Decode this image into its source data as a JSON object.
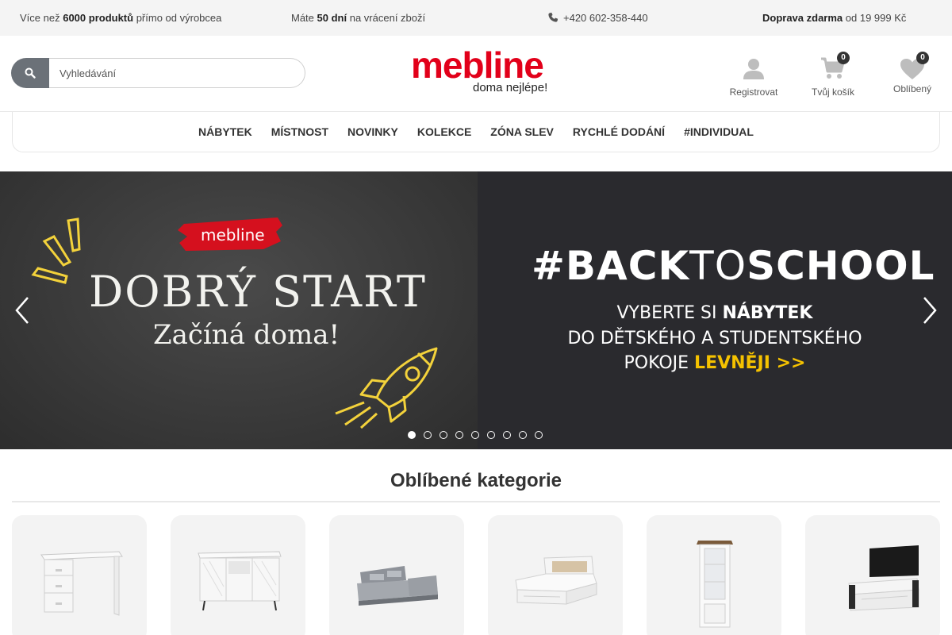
{
  "topbar": {
    "item1_prefix": "Více než",
    "item1_bold": "6000 produktů",
    "item1_suffix": "přímo od výrobcea",
    "item2_prefix": "Máte",
    "item2_bold": "50 dní",
    "item2_suffix": "na vrácení zboží",
    "phone": "+420 602-358-440",
    "phone_icon": "phone-icon",
    "item4_bold": "Doprava zdarma",
    "item4_suffix": "od 19 999 Kč"
  },
  "search": {
    "placeholder": "Vyhledávání",
    "icon": "search-icon"
  },
  "logo": {
    "main": "mebline",
    "tagline": "doma nejlépe!"
  },
  "header_actions": {
    "register": {
      "label": "Registrovat",
      "icon": "user-icon"
    },
    "cart": {
      "label": "Tvůj košík",
      "count": "0",
      "icon": "cart-icon"
    },
    "favorites": {
      "label": "Oblíbený",
      "count": "0",
      "icon": "heart-icon"
    }
  },
  "nav": {
    "items": [
      "NÁBYTEK",
      "MÍSTNOST",
      "NOVINKY",
      "KOLEKCE",
      "ZÓNA SLEV",
      "RYCHLÉ DODÁNÍ",
      "#INDIVIDUAL"
    ]
  },
  "hero": {
    "left": {
      "brand": "mebline",
      "title": "DOBRÝ START",
      "subtitle": "Začíná doma!"
    },
    "right": {
      "hashtag": "#",
      "back": "BACK",
      "to": "TO",
      "school": "SCHOOL",
      "line1_prefix": "VYBERTE SI",
      "line1_bold": "NÁBYTEK",
      "line2": "DO DĚTSKÉHO A STUDENTSKÉHO",
      "line3_prefix": "POKOJE",
      "line3_cta": "LEVNĚJI >>"
    },
    "slides_total": 9,
    "active_slide": 1,
    "colors": {
      "accent_red": "#e2001a",
      "accent_yellow": "#f5c200"
    }
  },
  "categories": {
    "title": "Oblíbené kategorie",
    "items": [
      {
        "icon": "desk-image"
      },
      {
        "icon": "sideboard-image"
      },
      {
        "icon": "sofa-image"
      },
      {
        "icon": "bed-image"
      },
      {
        "icon": "display-cabinet-image"
      },
      {
        "icon": "tv-stand-image"
      }
    ]
  }
}
